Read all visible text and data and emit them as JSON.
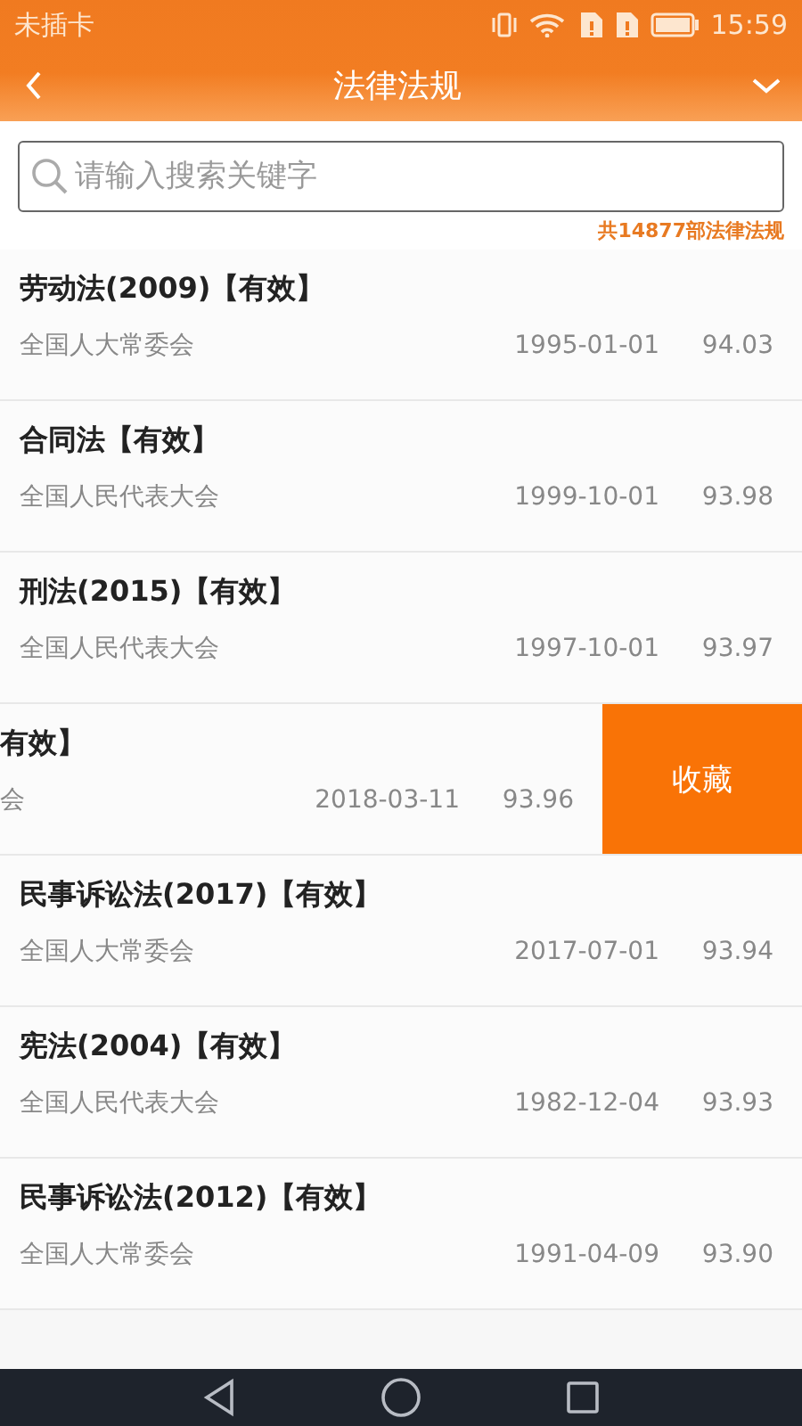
{
  "status_bar": {
    "carrier": "未插卡",
    "time": "15:59"
  },
  "header": {
    "title": "法律法规"
  },
  "search": {
    "placeholder": "请输入搜索关键字"
  },
  "total": "共14877部法律法规",
  "laws": [
    {
      "title": "劳动法(2009)【有效】",
      "issuer": "全国人大常委会",
      "date": "1995-01-01",
      "score": "94.03",
      "swiped": false
    },
    {
      "title": "合同法【有效】",
      "issuer": "全国人民代表大会",
      "date": "1999-10-01",
      "score": "93.98",
      "swiped": false
    },
    {
      "title": "刑法(2015)【有效】",
      "issuer": "全国人民代表大会",
      "date": "1997-10-01",
      "score": "93.97",
      "swiped": false
    },
    {
      "title": "有效】",
      "issuer": "会",
      "date": "2018-03-11",
      "score": "93.96",
      "swiped": true,
      "action": "收藏"
    },
    {
      "title": "民事诉讼法(2017)【有效】",
      "issuer": "全国人大常委会",
      "date": "2017-07-01",
      "score": "93.94",
      "swiped": false
    },
    {
      "title": "宪法(2004)【有效】",
      "issuer": "全国人民代表大会",
      "date": "1982-12-04",
      "score": "93.93",
      "swiped": false
    },
    {
      "title": "民事诉讼法(2012)【有效】",
      "issuer": "全国人大常委会",
      "date": "1991-04-09",
      "score": "93.90",
      "swiped": false
    }
  ]
}
